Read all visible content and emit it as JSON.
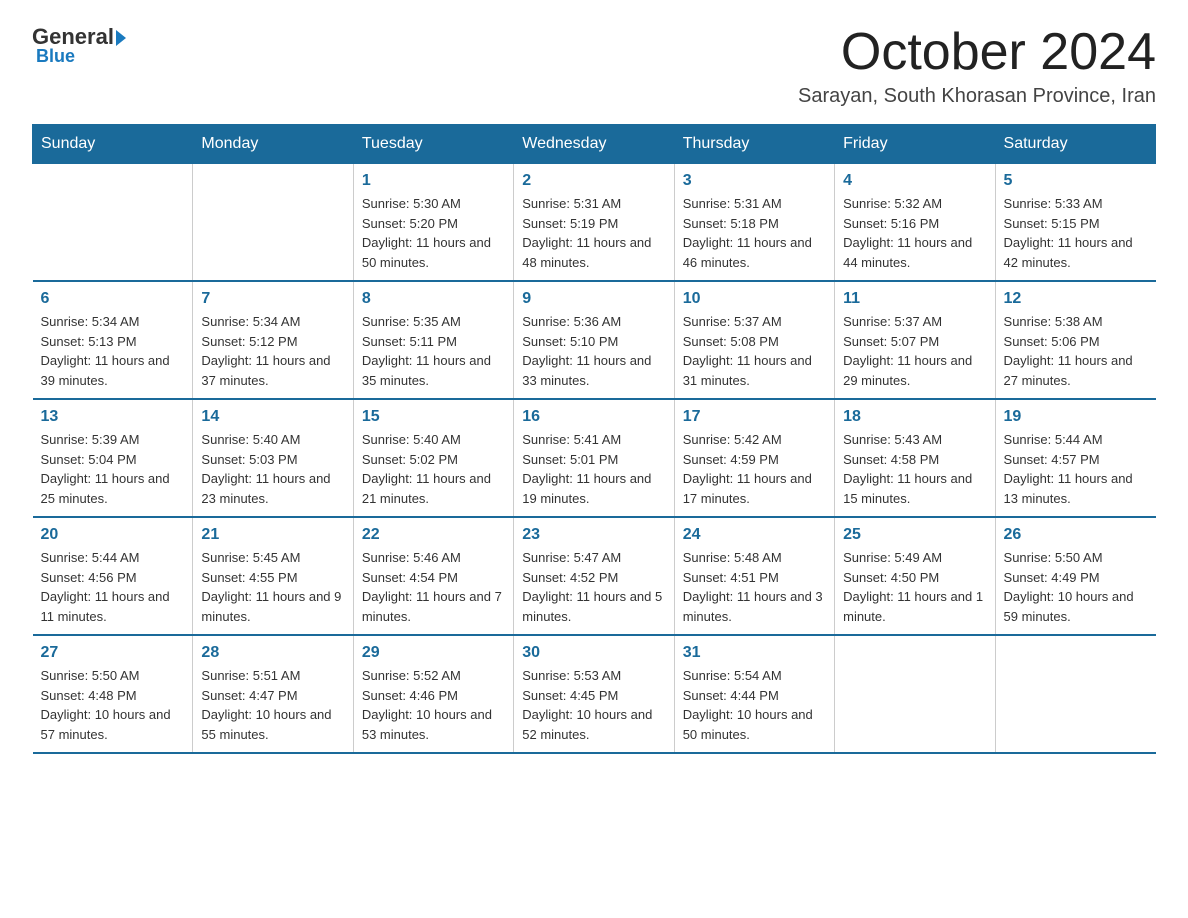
{
  "logo": {
    "text_general": "General",
    "text_blue": "Blue"
  },
  "header": {
    "title": "October 2024",
    "subtitle": "Sarayan, South Khorasan Province, Iran"
  },
  "weekdays": [
    "Sunday",
    "Monday",
    "Tuesday",
    "Wednesday",
    "Thursday",
    "Friday",
    "Saturday"
  ],
  "weeks": [
    [
      {
        "day": "",
        "sunrise": "",
        "sunset": "",
        "daylight": ""
      },
      {
        "day": "",
        "sunrise": "",
        "sunset": "",
        "daylight": ""
      },
      {
        "day": "1",
        "sunrise": "Sunrise: 5:30 AM",
        "sunset": "Sunset: 5:20 PM",
        "daylight": "Daylight: 11 hours and 50 minutes."
      },
      {
        "day": "2",
        "sunrise": "Sunrise: 5:31 AM",
        "sunset": "Sunset: 5:19 PM",
        "daylight": "Daylight: 11 hours and 48 minutes."
      },
      {
        "day": "3",
        "sunrise": "Sunrise: 5:31 AM",
        "sunset": "Sunset: 5:18 PM",
        "daylight": "Daylight: 11 hours and 46 minutes."
      },
      {
        "day": "4",
        "sunrise": "Sunrise: 5:32 AM",
        "sunset": "Sunset: 5:16 PM",
        "daylight": "Daylight: 11 hours and 44 minutes."
      },
      {
        "day": "5",
        "sunrise": "Sunrise: 5:33 AM",
        "sunset": "Sunset: 5:15 PM",
        "daylight": "Daylight: 11 hours and 42 minutes."
      }
    ],
    [
      {
        "day": "6",
        "sunrise": "Sunrise: 5:34 AM",
        "sunset": "Sunset: 5:13 PM",
        "daylight": "Daylight: 11 hours and 39 minutes."
      },
      {
        "day": "7",
        "sunrise": "Sunrise: 5:34 AM",
        "sunset": "Sunset: 5:12 PM",
        "daylight": "Daylight: 11 hours and 37 minutes."
      },
      {
        "day": "8",
        "sunrise": "Sunrise: 5:35 AM",
        "sunset": "Sunset: 5:11 PM",
        "daylight": "Daylight: 11 hours and 35 minutes."
      },
      {
        "day": "9",
        "sunrise": "Sunrise: 5:36 AM",
        "sunset": "Sunset: 5:10 PM",
        "daylight": "Daylight: 11 hours and 33 minutes."
      },
      {
        "day": "10",
        "sunrise": "Sunrise: 5:37 AM",
        "sunset": "Sunset: 5:08 PM",
        "daylight": "Daylight: 11 hours and 31 minutes."
      },
      {
        "day": "11",
        "sunrise": "Sunrise: 5:37 AM",
        "sunset": "Sunset: 5:07 PM",
        "daylight": "Daylight: 11 hours and 29 minutes."
      },
      {
        "day": "12",
        "sunrise": "Sunrise: 5:38 AM",
        "sunset": "Sunset: 5:06 PM",
        "daylight": "Daylight: 11 hours and 27 minutes."
      }
    ],
    [
      {
        "day": "13",
        "sunrise": "Sunrise: 5:39 AM",
        "sunset": "Sunset: 5:04 PM",
        "daylight": "Daylight: 11 hours and 25 minutes."
      },
      {
        "day": "14",
        "sunrise": "Sunrise: 5:40 AM",
        "sunset": "Sunset: 5:03 PM",
        "daylight": "Daylight: 11 hours and 23 minutes."
      },
      {
        "day": "15",
        "sunrise": "Sunrise: 5:40 AM",
        "sunset": "Sunset: 5:02 PM",
        "daylight": "Daylight: 11 hours and 21 minutes."
      },
      {
        "day": "16",
        "sunrise": "Sunrise: 5:41 AM",
        "sunset": "Sunset: 5:01 PM",
        "daylight": "Daylight: 11 hours and 19 minutes."
      },
      {
        "day": "17",
        "sunrise": "Sunrise: 5:42 AM",
        "sunset": "Sunset: 4:59 PM",
        "daylight": "Daylight: 11 hours and 17 minutes."
      },
      {
        "day": "18",
        "sunrise": "Sunrise: 5:43 AM",
        "sunset": "Sunset: 4:58 PM",
        "daylight": "Daylight: 11 hours and 15 minutes."
      },
      {
        "day": "19",
        "sunrise": "Sunrise: 5:44 AM",
        "sunset": "Sunset: 4:57 PM",
        "daylight": "Daylight: 11 hours and 13 minutes."
      }
    ],
    [
      {
        "day": "20",
        "sunrise": "Sunrise: 5:44 AM",
        "sunset": "Sunset: 4:56 PM",
        "daylight": "Daylight: 11 hours and 11 minutes."
      },
      {
        "day": "21",
        "sunrise": "Sunrise: 5:45 AM",
        "sunset": "Sunset: 4:55 PM",
        "daylight": "Daylight: 11 hours and 9 minutes."
      },
      {
        "day": "22",
        "sunrise": "Sunrise: 5:46 AM",
        "sunset": "Sunset: 4:54 PM",
        "daylight": "Daylight: 11 hours and 7 minutes."
      },
      {
        "day": "23",
        "sunrise": "Sunrise: 5:47 AM",
        "sunset": "Sunset: 4:52 PM",
        "daylight": "Daylight: 11 hours and 5 minutes."
      },
      {
        "day": "24",
        "sunrise": "Sunrise: 5:48 AM",
        "sunset": "Sunset: 4:51 PM",
        "daylight": "Daylight: 11 hours and 3 minutes."
      },
      {
        "day": "25",
        "sunrise": "Sunrise: 5:49 AM",
        "sunset": "Sunset: 4:50 PM",
        "daylight": "Daylight: 11 hours and 1 minute."
      },
      {
        "day": "26",
        "sunrise": "Sunrise: 5:50 AM",
        "sunset": "Sunset: 4:49 PM",
        "daylight": "Daylight: 10 hours and 59 minutes."
      }
    ],
    [
      {
        "day": "27",
        "sunrise": "Sunrise: 5:50 AM",
        "sunset": "Sunset: 4:48 PM",
        "daylight": "Daylight: 10 hours and 57 minutes."
      },
      {
        "day": "28",
        "sunrise": "Sunrise: 5:51 AM",
        "sunset": "Sunset: 4:47 PM",
        "daylight": "Daylight: 10 hours and 55 minutes."
      },
      {
        "day": "29",
        "sunrise": "Sunrise: 5:52 AM",
        "sunset": "Sunset: 4:46 PM",
        "daylight": "Daylight: 10 hours and 53 minutes."
      },
      {
        "day": "30",
        "sunrise": "Sunrise: 5:53 AM",
        "sunset": "Sunset: 4:45 PM",
        "daylight": "Daylight: 10 hours and 52 minutes."
      },
      {
        "day": "31",
        "sunrise": "Sunrise: 5:54 AM",
        "sunset": "Sunset: 4:44 PM",
        "daylight": "Daylight: 10 hours and 50 minutes."
      },
      {
        "day": "",
        "sunrise": "",
        "sunset": "",
        "daylight": ""
      },
      {
        "day": "",
        "sunrise": "",
        "sunset": "",
        "daylight": ""
      }
    ]
  ]
}
